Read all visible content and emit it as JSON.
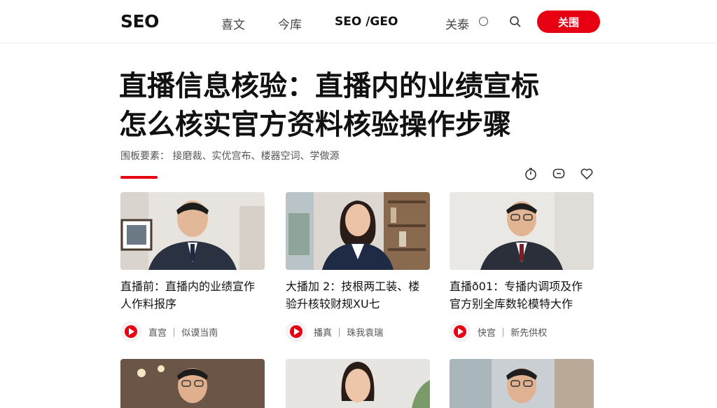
{
  "header": {
    "logo": "SEO",
    "nav": [
      "喜文",
      "今库",
      "SEO /GEO",
      "关泰"
    ],
    "follow_label": "关围"
  },
  "article": {
    "title_line1": "直播信息核验：直播内的业绩宣标",
    "title_line2": "怎么核实官方资料核验操作步骤",
    "keywords": "围板要素：  接磨裁、实优宫布、楼器空词、学做源"
  },
  "cards": [
    {
      "title_line1": "直播前：直播内的业绩宣作",
      "title_line2": "人作料报序",
      "meta": "直宫 ｜ 似谟当南"
    },
    {
      "title_line1": "大播加 2：技根两工装、楼",
      "title_line2": "验升核较财规XU七",
      "meta": "播真 ｜ 珠我袁瑞"
    },
    {
      "title_line1": "直播ð01：专播内调项及作",
      "title_line2": "官方别全库数轮模特大作",
      "meta": "快宫 ｜ 新先供权"
    }
  ],
  "colors": {
    "accent": "#e60012",
    "text": "#111111",
    "muted": "#555555"
  },
  "icons": [
    "search-icon",
    "globe-icon",
    "timer-icon",
    "comment-icon",
    "heart-icon",
    "play-icon"
  ]
}
